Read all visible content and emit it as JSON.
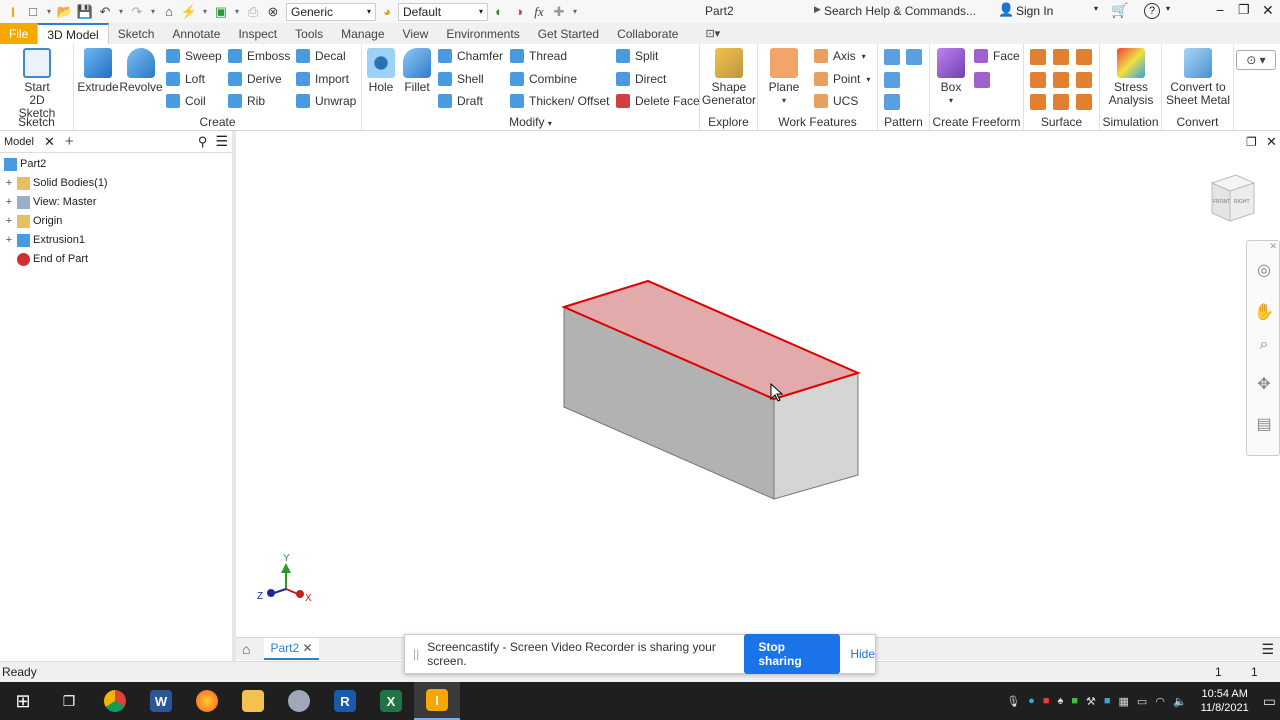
{
  "title_bar": {
    "app_letter": "I",
    "material": "Generic",
    "appearance": "Default",
    "fx_label": "fx",
    "doc_title": "Part2",
    "search_placeholder": "Search Help & Commands...",
    "sign_in": "Sign In"
  },
  "tabs": [
    "File",
    "3D Model",
    "Sketch",
    "Annotate",
    "Inspect",
    "Tools",
    "Manage",
    "View",
    "Environments",
    "Get Started",
    "Collaborate"
  ],
  "ribbon": {
    "sketch": {
      "title": "Sketch",
      "start_line1": "Start",
      "start_line2": "2D Sketch"
    },
    "create": {
      "title": "Create",
      "extrude": "Extrude",
      "revolve": "Revolve",
      "sweep": "Sweep",
      "loft": "Loft",
      "coil": "Coil",
      "emboss": "Emboss",
      "derive": "Derive",
      "rib": "Rib",
      "decal": "Decal",
      "import": "Import",
      "unwrap": "Unwrap"
    },
    "modify": {
      "title": "Modify",
      "hole": "Hole",
      "fillet": "Fillet",
      "chamfer": "Chamfer",
      "shell": "Shell",
      "draft": "Draft",
      "thread": "Thread",
      "combine": "Combine",
      "thicken": "Thicken/ Offset",
      "split": "Split",
      "direct": "Direct",
      "delete_face": "Delete Face"
    },
    "explore": {
      "title": "Explore",
      "shape_line1": "Shape",
      "shape_line2": "Generator"
    },
    "work": {
      "title": "Work Features",
      "plane": "Plane",
      "axis": "Axis",
      "point": "Point",
      "ucs": "UCS"
    },
    "pattern": {
      "title": "Pattern"
    },
    "freeform": {
      "title": "Create Freeform",
      "box": "Box",
      "face": "Face"
    },
    "surface": {
      "title": "Surface"
    },
    "simulation": {
      "title": "Simulation",
      "stress_line1": "Stress",
      "stress_line2": "Analysis"
    },
    "convert": {
      "title": "Convert",
      "line1": "Convert to",
      "line2": "Sheet Metal"
    }
  },
  "browser": {
    "tab_label": "Model",
    "items": [
      "Part2",
      "Solid Bodies(1)",
      "View: Master",
      "Origin",
      "Extrusion1",
      "End of Part"
    ]
  },
  "viewcube": {
    "face1": "FRONT",
    "face2": "RIGHT"
  },
  "triad": {
    "x": "X",
    "y": "Y",
    "z": "Z"
  },
  "doc_tab": "Part2",
  "status": {
    "text": "Ready",
    "num1": "1",
    "num2": "1"
  },
  "notification": {
    "text": "Screencastify - Screen Video Recorder is sharing your screen.",
    "stop": "Stop sharing",
    "hide": "Hide"
  },
  "taskbar": {
    "time": "10:54 AM",
    "date": "11/8/2021"
  },
  "colors": {
    "accent": "#2c7fd3",
    "file_tab": "#f6a800",
    "highlight_face": "#e2aaaa",
    "highlight_edge": "#e00000",
    "stop_button": "#1a73e8"
  }
}
